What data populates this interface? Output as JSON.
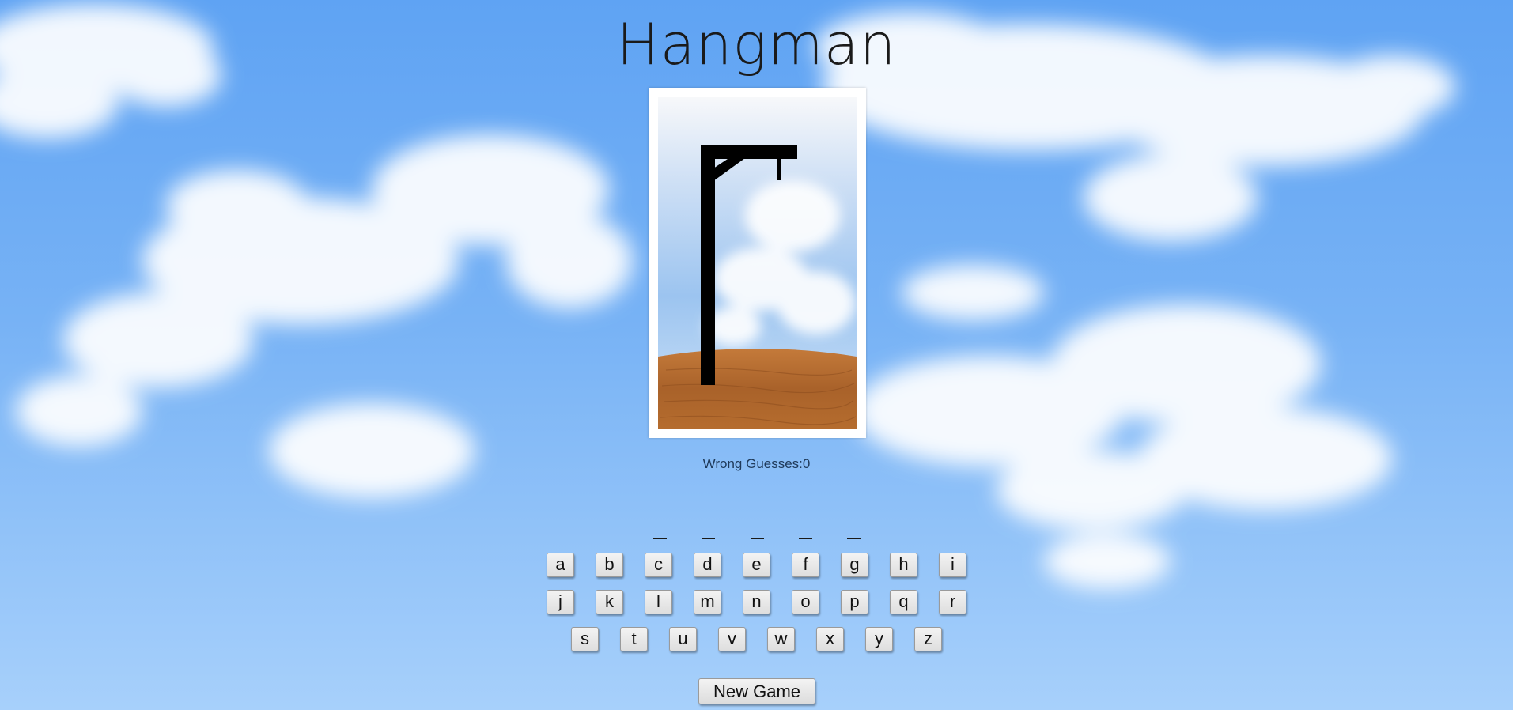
{
  "game": {
    "title": "Hangman",
    "wrong_guesses_label": "Wrong Guesses:",
    "wrong_guesses": 0,
    "wrong_guesses_text": "Wrong Guesses:0",
    "word_length": 5,
    "revealed_letters": [
      "",
      "",
      "",
      "",
      ""
    ],
    "new_game_label": "New Game"
  },
  "keyboard": {
    "row1": [
      "a",
      "b",
      "c",
      "d",
      "e",
      "f",
      "g",
      "h",
      "i"
    ],
    "row2": [
      "j",
      "k",
      "l",
      "m",
      "n",
      "o",
      "p",
      "q",
      "r"
    ],
    "row3": [
      "s",
      "t",
      "u",
      "v",
      "w",
      "x",
      "y",
      "z"
    ]
  },
  "colors": {
    "sky_top": "#5fa3f3",
    "sky_bottom": "#a7d0fb",
    "gallows": "#000000",
    "ground": "#b06a33",
    "card_bg": "#ffffff"
  },
  "icons": {
    "gallows": "gallows-drawing"
  }
}
